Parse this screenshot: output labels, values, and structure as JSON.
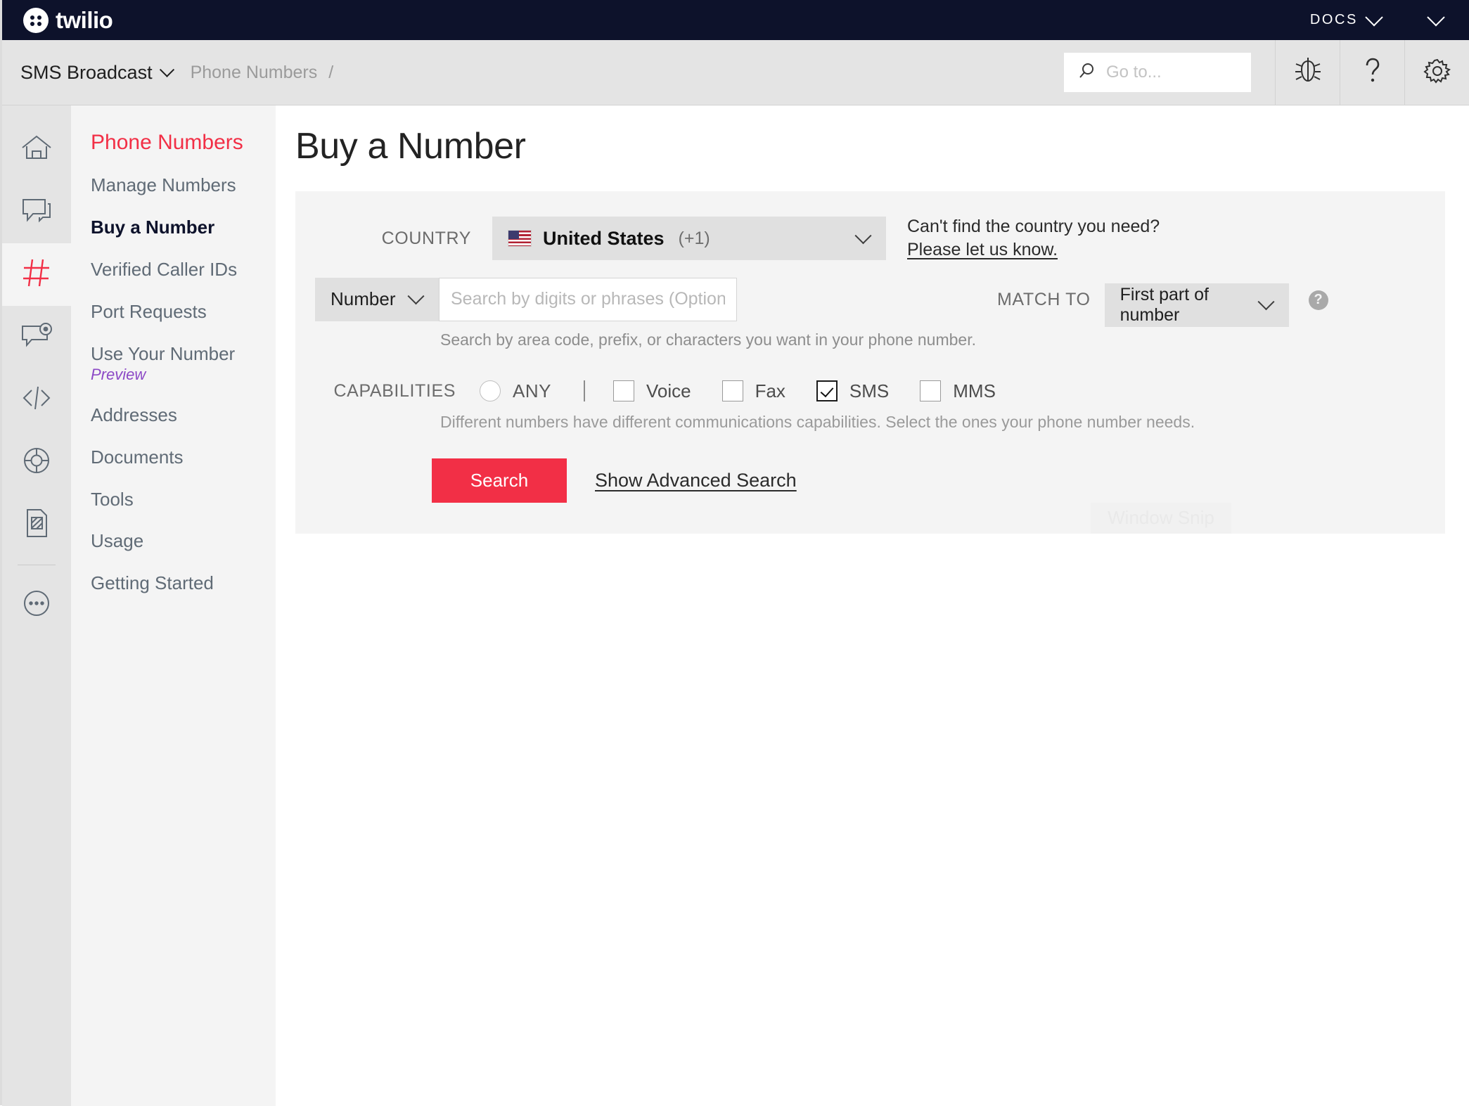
{
  "topbar": {
    "brand": "twilio",
    "docs_label": "DOCS",
    "account_caret_icon": "chevron-down-icon"
  },
  "subbar": {
    "project": "SMS Broadcast",
    "breadcrumb": "Phone Numbers",
    "breadcrumb_separator": "/",
    "search_placeholder": "Go to...",
    "search_value": "",
    "icons": [
      "bug-icon",
      "help-icon",
      "gear-icon"
    ]
  },
  "rail": {
    "items": [
      {
        "name": "home-icon"
      },
      {
        "name": "messaging-icon"
      },
      {
        "name": "phone-numbers-icon",
        "active": true
      },
      {
        "name": "programmable-chat-icon"
      },
      {
        "name": "code-icon"
      },
      {
        "name": "lifebuoy-icon"
      },
      {
        "name": "sim-card-icon"
      },
      {
        "name": "more-icon"
      }
    ]
  },
  "subnav": {
    "title": "Phone Numbers",
    "items": [
      {
        "label": "Manage Numbers",
        "active": false
      },
      {
        "label": "Buy a Number",
        "active": true
      },
      {
        "label": "Verified Caller IDs",
        "active": false
      },
      {
        "label": "Port Requests",
        "active": false
      },
      {
        "label": "Use Your Number",
        "badge": "Preview",
        "active": false
      },
      {
        "label": "Addresses",
        "active": false
      },
      {
        "label": "Documents",
        "active": false
      },
      {
        "label": "Tools",
        "active": false
      },
      {
        "label": "Usage",
        "active": false
      },
      {
        "label": "Getting Started",
        "active": false
      }
    ]
  },
  "main": {
    "page_title": "Buy a Number",
    "country": {
      "label": "COUNTRY",
      "flag": "us-flag-icon",
      "value": "United States",
      "dial_code": "(+1)"
    },
    "country_note": {
      "line1": "Can't find the country you need?",
      "link": "Please let us know."
    },
    "search": {
      "type_value": "Number",
      "placeholder": "Search by digits or phrases (Optional)",
      "value": "",
      "hint": "Search by area code, prefix, or characters you want in your phone number.",
      "match_label": "MATCH TO",
      "match_value": "First part of number",
      "help_glyph": "?"
    },
    "capabilities": {
      "label": "CAPABILITIES",
      "any_label": "ANY",
      "any_selected": false,
      "options": [
        {
          "label": "Voice",
          "checked": false
        },
        {
          "label": "Fax",
          "checked": false
        },
        {
          "label": "SMS",
          "checked": true
        },
        {
          "label": "MMS",
          "checked": false
        }
      ],
      "hint": "Different numbers have different communications capabilities. Select the ones your phone number needs."
    },
    "actions": {
      "search_button": "Search",
      "advanced_link": "Show Advanced Search"
    },
    "watermark": "Window Snip"
  },
  "colors": {
    "brand_red": "#f22f46",
    "topbar_navy": "#0d122b",
    "preview_purple": "#8c49c6"
  }
}
